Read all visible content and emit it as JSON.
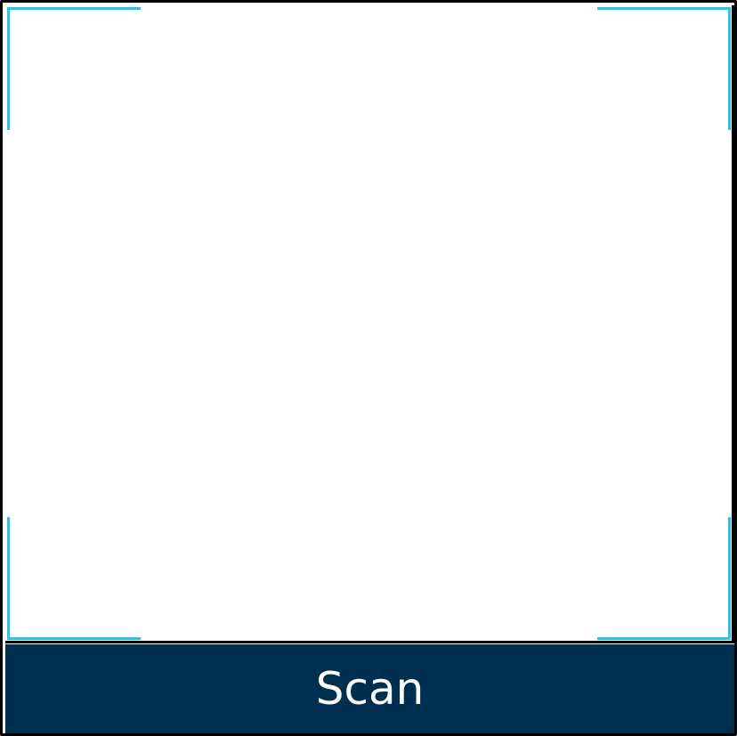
{
  "scanner": {
    "button_label": "Scan"
  },
  "colors": {
    "frame_corner": "#29c3e6",
    "button_background": "#00304f",
    "button_text": "#ffffff",
    "outer_border": "#000000"
  }
}
